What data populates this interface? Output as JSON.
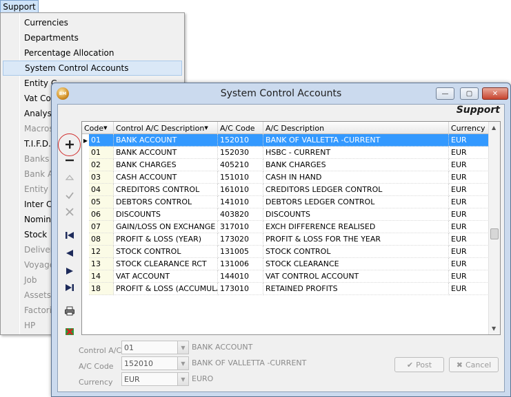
{
  "menubar": {
    "label": "Support"
  },
  "menu": {
    "items": [
      {
        "label": "Currencies",
        "enabled": true
      },
      {
        "label": "Departments",
        "enabled": true
      },
      {
        "label": "Percentage Allocation",
        "enabled": true
      },
      {
        "label": "System Control Accounts",
        "enabled": true,
        "highlighted": true
      },
      {
        "label": "Entity G",
        "enabled": true
      },
      {
        "label": "Vat Coo",
        "enabled": true
      },
      {
        "label": "Analysi",
        "enabled": true
      },
      {
        "label": "Macros",
        "enabled": false
      },
      {
        "label": "T.I.F.D.",
        "enabled": true
      },
      {
        "label": "Banks",
        "enabled": false
      },
      {
        "label": "Bank Ac",
        "enabled": false
      },
      {
        "label": "Entity C",
        "enabled": false
      },
      {
        "label": "Inter Co",
        "enabled": true
      },
      {
        "label": "Nomina",
        "enabled": true
      },
      {
        "label": "Stock",
        "enabled": true
      },
      {
        "label": "Delivery",
        "enabled": false
      },
      {
        "label": "Voyage",
        "enabled": false
      },
      {
        "label": "Job",
        "enabled": false
      },
      {
        "label": "Assets",
        "enabled": false
      },
      {
        "label": "Factorin",
        "enabled": false
      },
      {
        "label": "HP",
        "enabled": false
      }
    ]
  },
  "window": {
    "title": "System Control Accounts",
    "brand": "Support",
    "app_icon_text": "BM",
    "buttons": {
      "minimize": "—",
      "maximize": "▢",
      "close": "✕"
    }
  },
  "grid": {
    "columns": [
      "Code",
      "Control A/C Description",
      "A/C Code",
      "A/C Description",
      "Currency"
    ],
    "rows": [
      [
        "01",
        "BANK ACCOUNT",
        "152010",
        "BANK OF VALLETTA -CURRENT",
        "EUR"
      ],
      [
        "01",
        "BANK ACCOUNT",
        "152030",
        "HSBC - CURRENT",
        "EUR"
      ],
      [
        "02",
        "BANK CHARGES",
        "405210",
        "BANK CHARGES",
        "EUR"
      ],
      [
        "03",
        "CASH ACCOUNT",
        "151010",
        "CASH IN HAND",
        "EUR"
      ],
      [
        "04",
        "CREDITORS CONTROL",
        "161010",
        "CREDITORS LEDGER CONTROL",
        "EUR"
      ],
      [
        "05",
        "DEBTORS CONTROL",
        "141010",
        "DEBTORS LEDGER CONTROL",
        "EUR"
      ],
      [
        "06",
        "DISCOUNTS",
        "403820",
        "DISCOUNTS",
        "EUR"
      ],
      [
        "07",
        "GAIN/LOSS ON EXCHANGE",
        "317010",
        "EXCH DIFFERENCE REALISED",
        "EUR"
      ],
      [
        "08",
        "PROFIT & LOSS (YEAR)",
        "173020",
        "PROFIT & LOSS FOR THE YEAR",
        "EUR"
      ],
      [
        "12",
        "STOCK CONTROL",
        "131005",
        "STOCK CONTROL",
        "EUR"
      ],
      [
        "13",
        "STOCK CLEARANCE RCT",
        "131006",
        "STOCK CLEARANCE",
        "EUR"
      ],
      [
        "14",
        "VAT ACCOUNT",
        "144010",
        "VAT CONTROL ACCOUNT",
        "EUR"
      ],
      [
        "18",
        "PROFIT & LOSS (ACCUMULATE",
        "173010",
        "RETAINED PROFITS",
        "EUR"
      ]
    ],
    "selected_row": 0
  },
  "detail": {
    "control_ac_label": "Control A/C",
    "control_ac_value": "01",
    "control_ac_desc": "BANK ACCOUNT",
    "ac_code_label": "A/C Code",
    "ac_code_value": "152010",
    "ac_code_desc": "BANK OF VALLETTA -CURRENT",
    "currency_label": "Currency",
    "currency_value": "EUR",
    "currency_desc": "EURO",
    "post_label": "Post",
    "cancel_label": "Cancel"
  },
  "colors": {
    "selection": "#3399ff",
    "annotation_circle": "#d02a2a"
  }
}
